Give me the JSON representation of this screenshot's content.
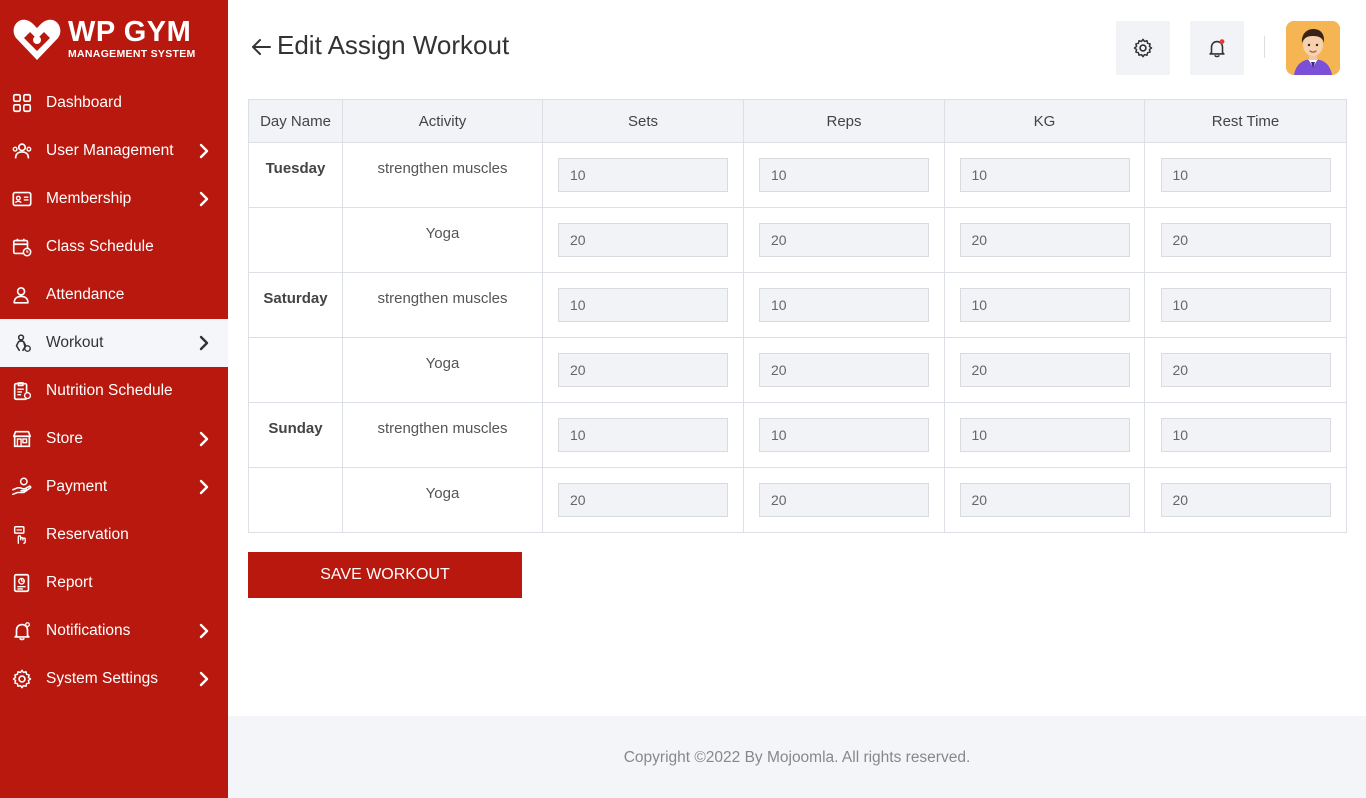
{
  "brand": {
    "title": "WP GYM",
    "subtitle": "MANAGEMENT SYSTEM"
  },
  "colors": {
    "brand_red": "#b8180d",
    "active_bg": "#f4f6fa",
    "input_bg": "#f1f3f7",
    "notification_dot": "#e53935"
  },
  "sidebar": {
    "items": [
      {
        "label": "Dashboard",
        "icon": "dashboard-icon",
        "has_submenu": false,
        "active": false
      },
      {
        "label": "User Management",
        "icon": "users-icon",
        "has_submenu": true,
        "active": false
      },
      {
        "label": "Membership",
        "icon": "membership-card-icon",
        "has_submenu": true,
        "active": false
      },
      {
        "label": "Class Schedule",
        "icon": "calendar-clock-icon",
        "has_submenu": false,
        "active": false
      },
      {
        "label": "Attendance",
        "icon": "user-check-icon",
        "has_submenu": false,
        "active": false
      },
      {
        "label": "Workout",
        "icon": "workout-icon",
        "has_submenu": true,
        "active": true
      },
      {
        "label": "Nutrition Schedule",
        "icon": "nutrition-clipboard-icon",
        "has_submenu": false,
        "active": false
      },
      {
        "label": "Store",
        "icon": "store-icon",
        "has_submenu": true,
        "active": false
      },
      {
        "label": "Payment",
        "icon": "payment-hand-icon",
        "has_submenu": true,
        "active": false
      },
      {
        "label": "Reservation",
        "icon": "reservation-icon",
        "has_submenu": false,
        "active": false
      },
      {
        "label": "Report",
        "icon": "report-icon",
        "has_submenu": false,
        "active": false
      },
      {
        "label": "Notifications",
        "icon": "bell-icon",
        "has_submenu": true,
        "active": false
      },
      {
        "label": "System Settings",
        "icon": "gear-icon",
        "has_submenu": true,
        "active": false
      }
    ]
  },
  "header": {
    "title": "Edit Assign Workout",
    "settings_icon": "gear-icon",
    "notification_icon": "bell-icon",
    "avatar_icon": "user-avatar"
  },
  "table": {
    "columns": [
      "Day Name",
      "Activity",
      "Sets",
      "Reps",
      "KG",
      "Rest Time"
    ],
    "rows": [
      {
        "day": "Tuesday",
        "activity": "strengthen muscles",
        "sets": "10",
        "reps": "10",
        "kg": "10",
        "rest": "10"
      },
      {
        "day": "",
        "activity": "Yoga",
        "sets": "20",
        "reps": "20",
        "kg": "20",
        "rest": "20"
      },
      {
        "day": "Saturday",
        "activity": "strengthen muscles",
        "sets": "10",
        "reps": "10",
        "kg": "10",
        "rest": "10"
      },
      {
        "day": "",
        "activity": "Yoga",
        "sets": "20",
        "reps": "20",
        "kg": "20",
        "rest": "20"
      },
      {
        "day": "Sunday",
        "activity": "strengthen muscles",
        "sets": "10",
        "reps": "10",
        "kg": "10",
        "rest": "10"
      },
      {
        "day": "",
        "activity": "Yoga",
        "sets": "20",
        "reps": "20",
        "kg": "20",
        "rest": "20"
      }
    ]
  },
  "actions": {
    "save_label": "SAVE WORKOUT"
  },
  "footer": {
    "text": "Copyright ©2022 By Mojoomla. All rights reserved."
  }
}
